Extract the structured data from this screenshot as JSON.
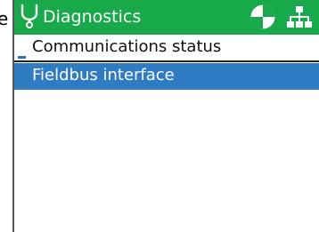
{
  "edge_glyph": "e",
  "title_bar": {
    "title": "Diagnostics",
    "left_icon": "stethoscope-icon",
    "right_icons": [
      "status-pie-icon",
      "network-tree-icon"
    ],
    "background_color": "#17a94a"
  },
  "menu": {
    "heading": "Communications status",
    "items": [
      {
        "label": "Fieldbus interface",
        "selected": true
      }
    ],
    "selection_color": "#2f7cc4"
  }
}
